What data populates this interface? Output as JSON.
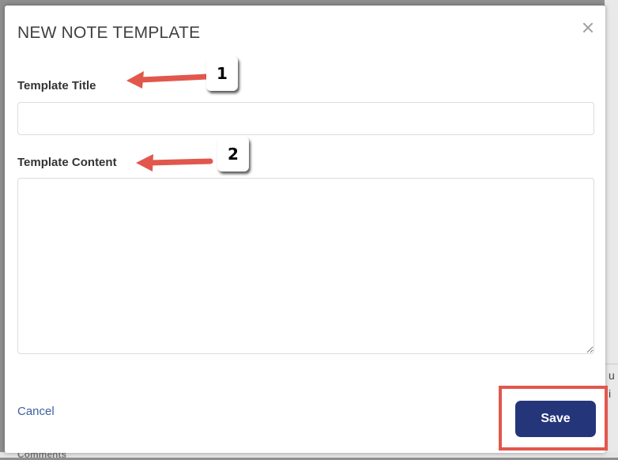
{
  "background": {
    "right_fragments": [
      "u",
      "i"
    ],
    "bottom_fragment": "Comments"
  },
  "modal": {
    "title": "NEW NOTE TEMPLATE",
    "close_icon": "close-icon",
    "template_title_label": "Template Title",
    "template_title_value": "",
    "template_content_label": "Template Content",
    "template_content_value": "",
    "cancel_label": "Cancel",
    "save_label": "Save"
  },
  "annotations": {
    "callout_1": "1",
    "callout_2": "2",
    "accent_color": "#e2574c"
  },
  "colors": {
    "save_button": "#25357a",
    "cancel_link": "#3b5fa0"
  }
}
